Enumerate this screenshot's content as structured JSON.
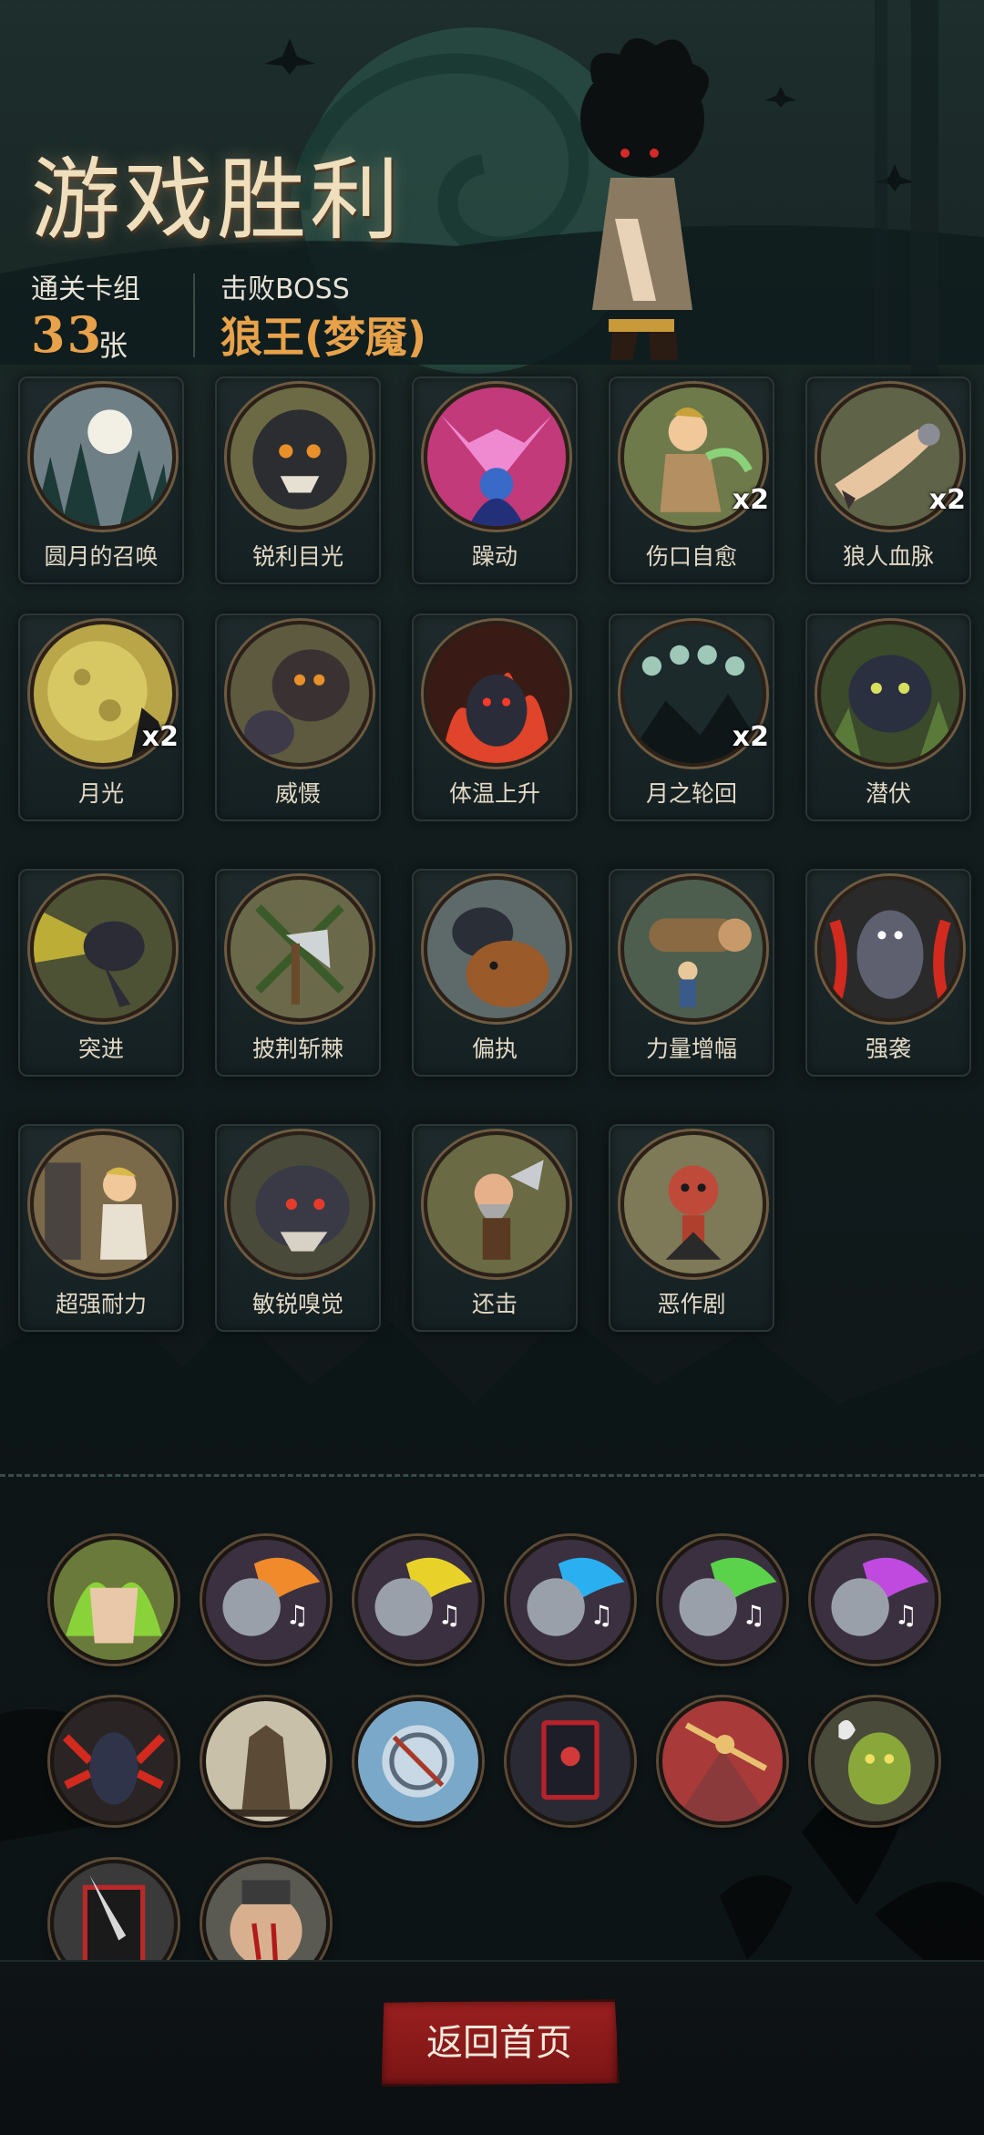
{
  "header": {
    "title": "游戏胜利",
    "deck_label": "通关卡组",
    "deck_count": "33",
    "deck_unit": "张",
    "boss_label": "击败BOSS",
    "boss_name": "狼王(梦魇)"
  },
  "colors": {
    "accent": "#e8a24a",
    "title": "#f0dfbd",
    "button": "#8f1c1c",
    "background": "#152022"
  },
  "cards": [
    {
      "name": "圆月的召唤",
      "multiplier": "",
      "icon": "full-moon-forest-icon"
    },
    {
      "name": "锐利目光",
      "multiplier": "",
      "icon": "werewolf-glare-icon"
    },
    {
      "name": "躁动",
      "multiplier": "",
      "icon": "restless-magic-icon"
    },
    {
      "name": "伤口自愈",
      "multiplier": "x2",
      "icon": "wound-heal-icon"
    },
    {
      "name": "狼人血脉",
      "multiplier": "x2",
      "icon": "werewolf-arm-icon"
    },
    {
      "name": "月光",
      "multiplier": "x2",
      "icon": "moonlight-icon"
    },
    {
      "name": "威慑",
      "multiplier": "",
      "icon": "deterrence-wolf-icon"
    },
    {
      "name": "体温上升",
      "multiplier": "",
      "icon": "fire-wolf-icon"
    },
    {
      "name": "月之轮回",
      "multiplier": "x2",
      "icon": "moon-phases-icon"
    },
    {
      "name": "潜伏",
      "multiplier": "",
      "icon": "lurking-wolf-icon"
    },
    {
      "name": "突进",
      "multiplier": "",
      "icon": "dash-wolf-icon"
    },
    {
      "name": "披荆斩棘",
      "multiplier": "",
      "icon": "axe-thorns-icon"
    },
    {
      "name": "偏执",
      "multiplier": "",
      "icon": "wolf-bear-icon"
    },
    {
      "name": "力量增幅",
      "multiplier": "",
      "icon": "log-lift-icon"
    },
    {
      "name": "强袭",
      "multiplier": "",
      "icon": "raging-werewolf-icon"
    },
    {
      "name": "超强耐力",
      "multiplier": "",
      "icon": "endurance-boy-icon"
    },
    {
      "name": "敏锐嗅觉",
      "multiplier": "",
      "icon": "sniffing-wolf-icon"
    },
    {
      "name": "还击",
      "multiplier": "",
      "icon": "dwarf-counter-icon"
    },
    {
      "name": "恶作剧",
      "multiplier": "",
      "icon": "prank-doll-icon"
    }
  ],
  "relics": [
    {
      "icon": "green-flame-torso-icon"
    },
    {
      "icon": "orange-note-skull-icon"
    },
    {
      "icon": "yellow-note-skull-icon"
    },
    {
      "icon": "blue-note-skull-icon"
    },
    {
      "icon": "green-note-skull-icon"
    },
    {
      "icon": "purple-note-skull-icon"
    },
    {
      "icon": "howling-werewolf-icon"
    },
    {
      "icon": "broken-altar-icon"
    },
    {
      "icon": "frozen-shield-icon"
    },
    {
      "icon": "red-spellbook-icon"
    },
    {
      "icon": "golden-warrior-icon"
    },
    {
      "icon": "green-ghoul-icon"
    },
    {
      "icon": "card-dagger-icon"
    },
    {
      "icon": "bloody-fist-icon"
    }
  ],
  "footer": {
    "home_button": "返回首页"
  }
}
